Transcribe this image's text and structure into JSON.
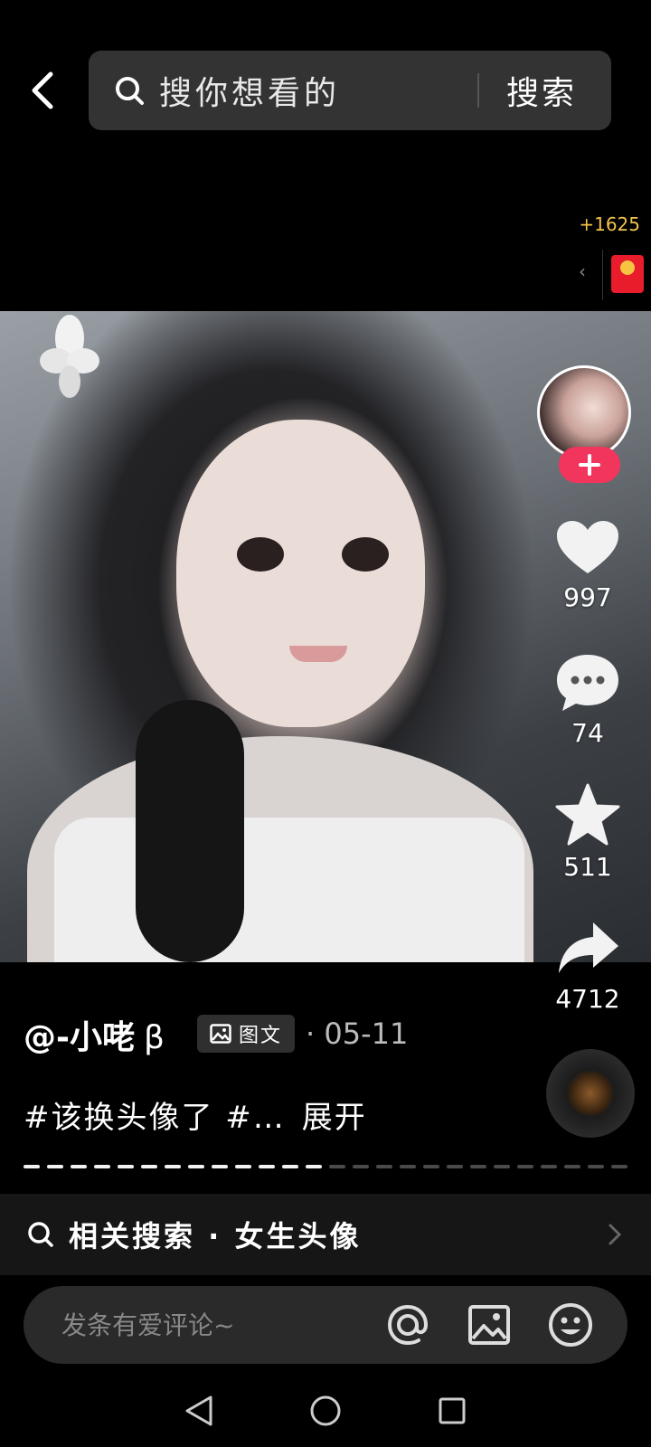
{
  "search": {
    "placeholder": "搜你想看的",
    "button_label": "搜索"
  },
  "red_packet": {
    "count": "+1625"
  },
  "actions": {
    "like_count": "997",
    "comment_count": "74",
    "favorite_count": "511",
    "share_count": "4712"
  },
  "post": {
    "author": "@-小咾",
    "author_suffix": "β",
    "type_label": "图文",
    "date": "· 05-11",
    "description": "#该换头像了 #…",
    "expand_label": "展开"
  },
  "progress": {
    "current_segment": 13,
    "total_segments": 26
  },
  "related_search": {
    "label": "相关搜索 · 女生头像"
  },
  "comment_bar": {
    "placeholder": "发条有爱评论~"
  },
  "colors": {
    "accent_pink": "#f2355c",
    "red_packet": "#e81c2a",
    "gold": "#f0c24a"
  }
}
